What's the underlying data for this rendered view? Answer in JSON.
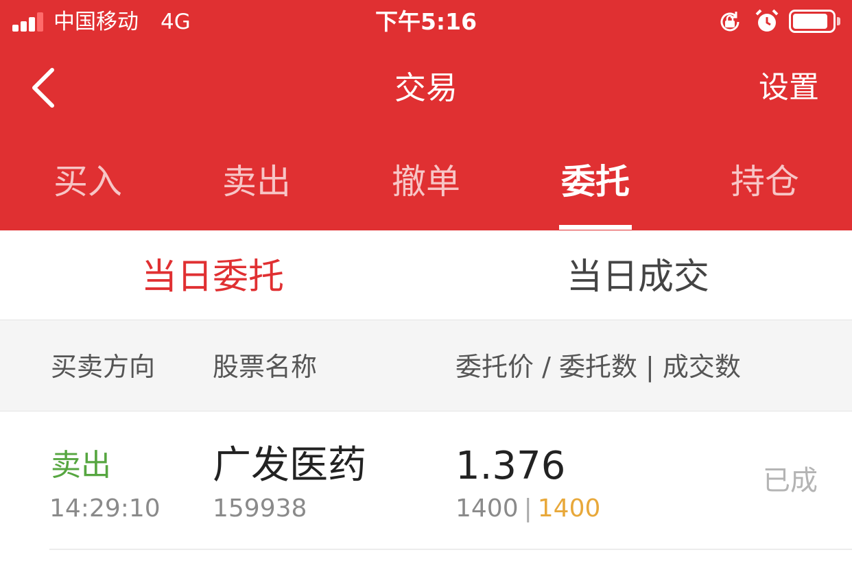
{
  "status_bar": {
    "carrier": "中国移动",
    "network": "4G",
    "time": "下午5:16"
  },
  "nav": {
    "title": "交易",
    "settings": "设置"
  },
  "top_tabs": [
    {
      "label": "买入"
    },
    {
      "label": "卖出"
    },
    {
      "label": "撤单"
    },
    {
      "label": "委托",
      "active": true
    },
    {
      "label": "持仓"
    }
  ],
  "sub_tabs": [
    {
      "label": "当日委托",
      "active": true
    },
    {
      "label": "当日成交"
    }
  ],
  "table": {
    "headers": {
      "direction": "买卖方向",
      "name": "股票名称",
      "price_qty": "委托价 / 委托数 | 成交数"
    },
    "rows": [
      {
        "direction": "卖出",
        "time": "14:29:10",
        "name": "广发医药",
        "code": "159938",
        "price": "1.376",
        "order_qty": "1400",
        "sep": "|",
        "filled_qty": "1400",
        "status": "已成"
      }
    ]
  },
  "colors": {
    "brand_red": "#e03032",
    "sell_green": "#56a640",
    "filled_orange": "#e8a83a"
  }
}
